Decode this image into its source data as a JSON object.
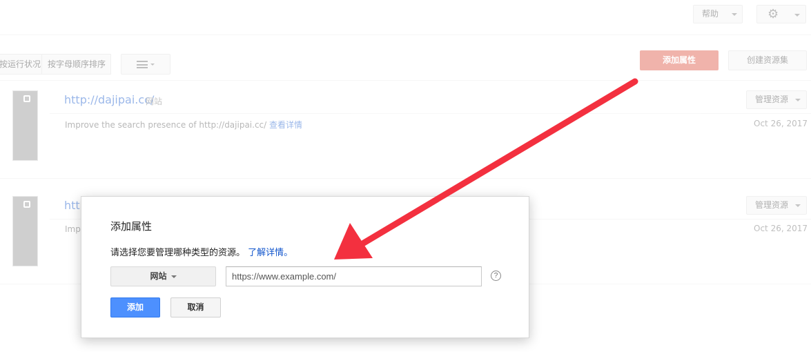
{
  "topbar": {
    "help_label": "帮助",
    "settings_icon": "gear-icon"
  },
  "toolbar": {
    "sort_health_label": "按运行状况",
    "sort_alpha_label": "按字母顺序排序",
    "view_icon": "list-icon",
    "add_property_label": "添加属性",
    "create_set_label": "创建资源集"
  },
  "sites": [
    {
      "url": "http://dajipai.cc/",
      "type": "网站",
      "desc": "Improve the search presence of http://dajipai.cc/",
      "details_link": "查看详情",
      "manage_label": "管理资源",
      "date": "Oct 26, 2017"
    },
    {
      "url_partial": "http",
      "desc_partial": "Impr",
      "manage_label": "管理资源",
      "date": "Oct 26, 2017"
    }
  ],
  "dialog": {
    "title": "添加属性",
    "prompt": "请选择您要管理哪种类型的资源。",
    "learn_more": "了解详情。",
    "type_value": "网站",
    "url_placeholder": "https://www.example.com/",
    "help_glyph": "?",
    "add_label": "添加",
    "cancel_label": "取消"
  },
  "colors": {
    "primary_red": "#dd4b39",
    "primary_blue": "#4d90fe",
    "link_blue": "#1155cc",
    "annotation_arrow": "#f3303f"
  }
}
